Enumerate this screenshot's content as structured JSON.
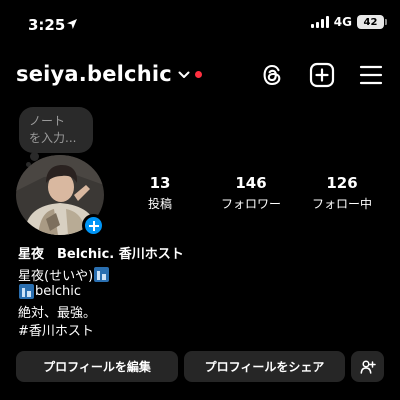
{
  "status_bar": {
    "time": "3:25",
    "network": "4G",
    "battery": "42"
  },
  "header": {
    "username": "seiya.belchic",
    "icons": [
      "location-arrow-icon",
      "chevron-down-icon",
      "threads-icon",
      "create-icon",
      "menu-icon"
    ]
  },
  "note": {
    "line1": "ノート",
    "line2": "を入力..."
  },
  "stats": [
    {
      "value": "13",
      "label": "投稿"
    },
    {
      "value": "146",
      "label": "フォロワー"
    },
    {
      "value": "126",
      "label": "フォロー中"
    }
  ],
  "bio": {
    "name": "星夜　Belchic. 香川ホスト",
    "line1": "星夜(せいや)",
    "line2": "belchic",
    "line3": "絶対、最強。",
    "line4": "#香川ホスト"
  },
  "buttons": {
    "edit": "プロフィールを編集",
    "share": "プロフィールをシェア"
  },
  "colors": {
    "background": "#000000",
    "button": "#262626",
    "accent_blue": "#0095f6",
    "notification_red": "#ff3040"
  }
}
